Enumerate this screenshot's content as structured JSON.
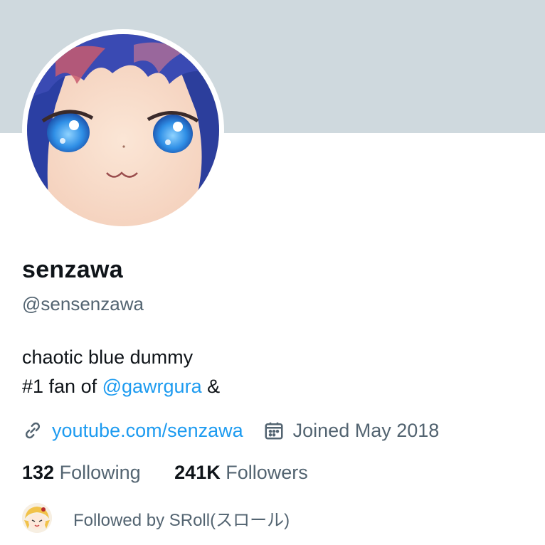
{
  "profile": {
    "display_name": "senzawa",
    "handle": "@sensenzawa",
    "bio": {
      "line1": "chaotic blue dummy",
      "line2_prefix": "#1 fan of",
      "mention": "@gawrgura",
      "line2_suffix": "&"
    },
    "website": "youtube.com/senzawa",
    "joined": "Joined May 2018"
  },
  "stats": {
    "following_count": "132",
    "following_label": "Following",
    "followers_count": "241K",
    "followers_label": "Followers"
  },
  "followed_by": {
    "text": "Followed by SRoll(スロール)"
  },
  "icons": {
    "website": "link-icon",
    "joined": "calendar-icon"
  },
  "colors": {
    "banner": "#cfd9de",
    "link": "#1d9bf0",
    "secondary_text": "#536471",
    "primary_text": "#0f1419"
  }
}
